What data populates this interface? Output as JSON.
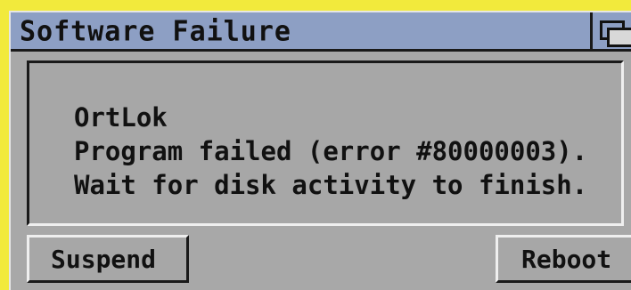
{
  "window": {
    "title": "Software Failure"
  },
  "message": {
    "line1": "OrtLok",
    "line2": "Program failed (error #80000003).",
    "line3": "Wait for disk activity to finish."
  },
  "buttons": {
    "suspend_label": "Suspend",
    "reboot_label": "Reboot"
  },
  "colors": {
    "titlebar": "#8d9fc4",
    "window_bg": "#a8a8a8",
    "outer_border": "#f2ea3c"
  },
  "icons": {
    "depth_gadget": "window-depth-icon"
  }
}
